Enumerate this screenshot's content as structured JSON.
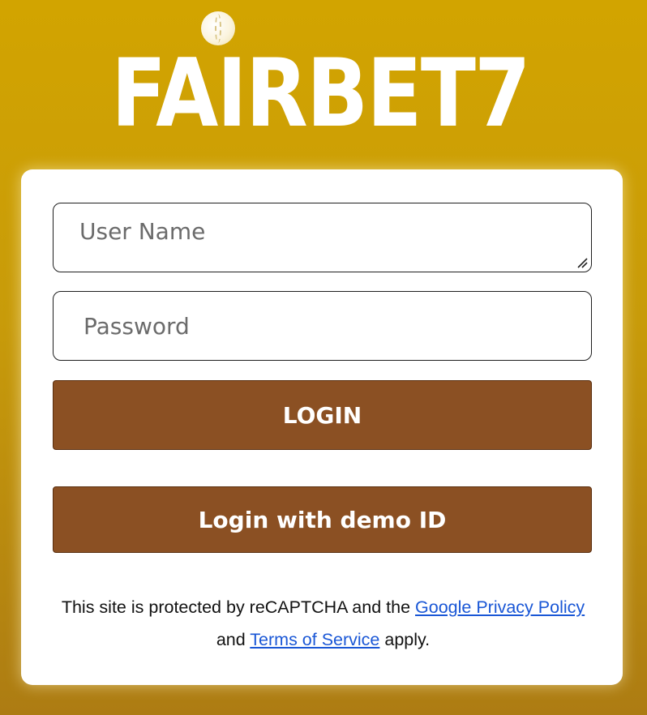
{
  "brand": {
    "logo_text": "FAIRBET7",
    "icon": "cricket-ball-icon"
  },
  "login_form": {
    "username_placeholder": "User Name",
    "password_placeholder": "Password",
    "login_button": "LOGIN",
    "demo_button": "Login with demo ID"
  },
  "recaptcha_notice": {
    "prefix": "This site is protected by reCAPTCHA and the ",
    "privacy_link": "Google Privacy Policy",
    "middle": " and ",
    "terms_link": "Terms of Service",
    "suffix": " apply."
  },
  "colors": {
    "background": "#c89b0a",
    "button": "#8b5023",
    "link": "#1a57d6"
  }
}
